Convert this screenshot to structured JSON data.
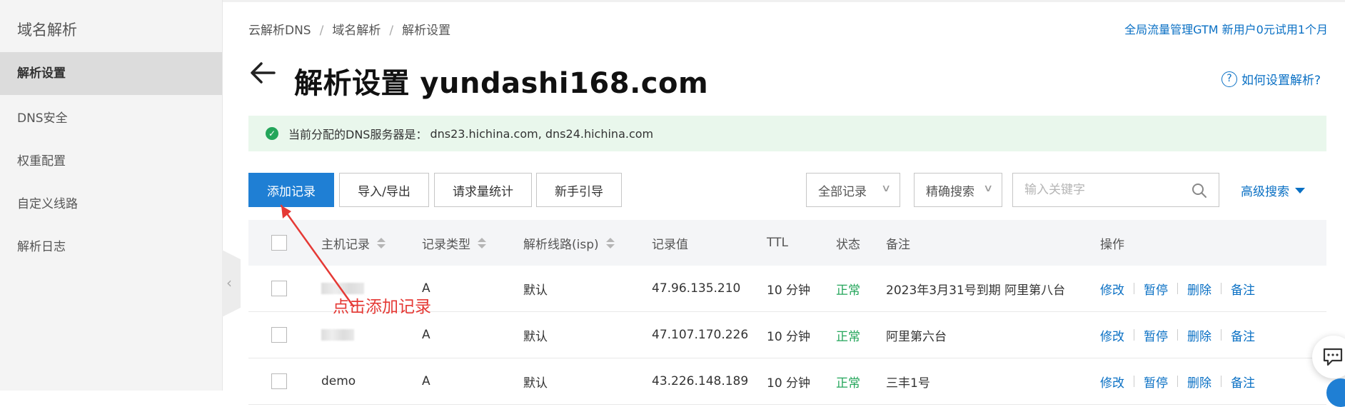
{
  "sidebar": {
    "title": "域名解析",
    "items": [
      {
        "label": "解析设置",
        "active": true
      },
      {
        "label": "DNS安全",
        "active": false
      },
      {
        "label": "权重配置",
        "active": false
      },
      {
        "label": "自定义线路",
        "active": false
      },
      {
        "label": "解析日志",
        "active": false
      }
    ]
  },
  "breadcrumb": [
    "云解析DNS",
    "域名解析",
    "解析设置"
  ],
  "promo_link": "全局流量管理GTM 新用户0元试用1个月",
  "page_title": "解析设置 yundashi168.com",
  "help_link": "如何设置解析?",
  "notice": {
    "label": "当前分配的DNS服务器是：",
    "value": "dns23.hichina.com, dns24.hichina.com"
  },
  "toolbar": {
    "add_record": "添加记录",
    "import_export": "导入/导出",
    "request_stats": "请求量统计",
    "guide": "新手引导",
    "filter_all": "全部记录",
    "exact_search": "精确搜索",
    "search_placeholder": "输入关键字",
    "advanced_search": "高级搜索"
  },
  "table": {
    "headers": {
      "host": "主机记录",
      "type": "记录类型",
      "line": "解析线路(isp)",
      "value": "记录值",
      "ttl": "TTL",
      "status": "状态",
      "remark": "备注",
      "actions": "操作"
    },
    "rows": [
      {
        "host": "",
        "type": "A",
        "line": "默认",
        "value": "47.96.135.210",
        "ttl": "10 分钟",
        "status": "正常",
        "remark": "2023年3月31号到期 阿里第八台"
      },
      {
        "host": "",
        "type": "A",
        "line": "默认",
        "value": "47.107.170.226",
        "ttl": "10 分钟",
        "status": "正常",
        "remark": "阿里第六台"
      },
      {
        "host": "demo",
        "type": "A",
        "line": "默认",
        "value": "43.226.148.189",
        "ttl": "10 分钟",
        "status": "正常",
        "remark": "三丰1号"
      }
    ],
    "actions": {
      "edit": "修改",
      "pause": "暂停",
      "delete": "删除",
      "note": "备注"
    }
  },
  "annotation": "点击添加记录",
  "colors": {
    "primary": "#1f7fd4",
    "link": "#0a70c4",
    "success": "#23a55a",
    "annotation": "#e53935",
    "notice_bg": "#e9f7ec"
  }
}
